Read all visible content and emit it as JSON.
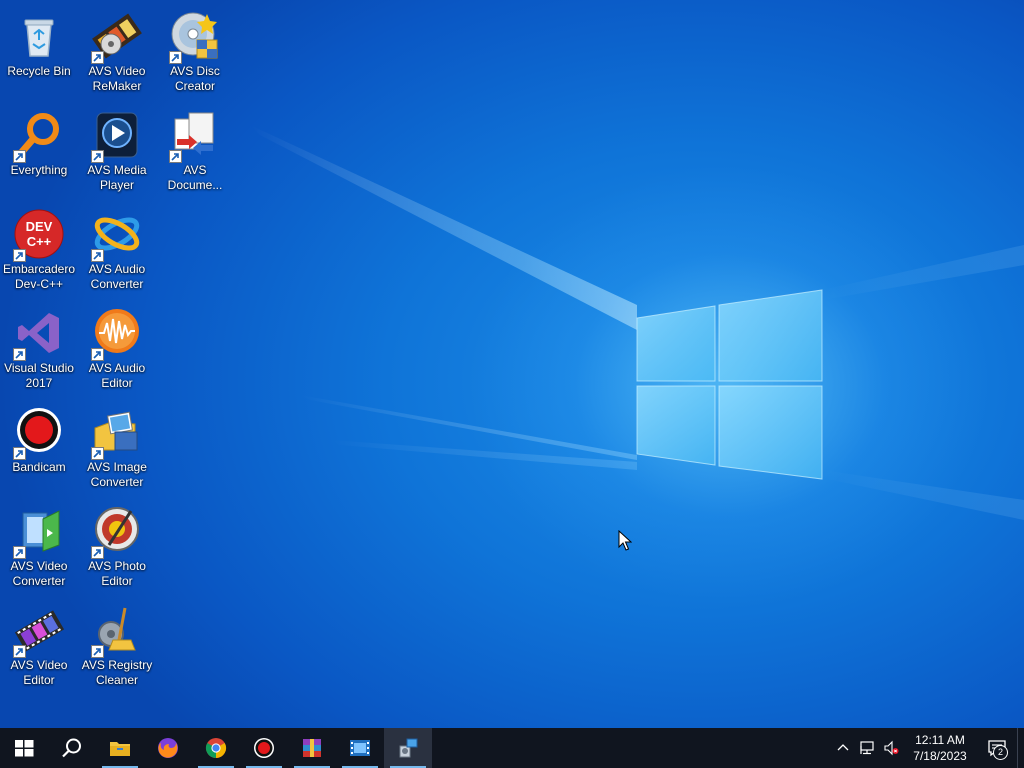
{
  "desktop": {
    "icons": [
      {
        "id": "recycle-bin",
        "label": "Recycle Bin",
        "shortcut": false
      },
      {
        "id": "everything",
        "label": "Everything",
        "shortcut": true
      },
      {
        "id": "devcpp",
        "label": "Embarcadero\nDev-C++",
        "shortcut": true,
        "logo_text": "DEV\nC++"
      },
      {
        "id": "vs2017",
        "label": "Visual Studio\n2017",
        "shortcut": true
      },
      {
        "id": "bandicam",
        "label": "Bandicam",
        "shortcut": true
      },
      {
        "id": "avs-video-converter",
        "label": "AVS Video\nConverter",
        "shortcut": true
      },
      {
        "id": "avs-video-editor",
        "label": "AVS Video\nEditor",
        "shortcut": true
      },
      {
        "id": "avs-video-remaker",
        "label": "AVS Video\nReMaker",
        "shortcut": true
      },
      {
        "id": "avs-media-player",
        "label": "AVS Media\nPlayer",
        "shortcut": true
      },
      {
        "id": "avs-audio-converter",
        "label": "AVS Audio\nConverter",
        "shortcut": true
      },
      {
        "id": "avs-audio-editor",
        "label": "AVS Audio\nEditor",
        "shortcut": true
      },
      {
        "id": "avs-image-converter",
        "label": "AVS Image\nConverter",
        "shortcut": true
      },
      {
        "id": "avs-photo-editor",
        "label": "AVS Photo\nEditor",
        "shortcut": true
      },
      {
        "id": "avs-registry-cleaner",
        "label": "AVS Registry\nCleaner",
        "shortcut": true
      },
      {
        "id": "avs-disc-creator",
        "label": "AVS Disc\nCreator",
        "shortcut": true
      },
      {
        "id": "avs-document-converter",
        "label": "AVS\nDocume...",
        "shortcut": true
      }
    ]
  },
  "taskbar": {
    "buttons": [
      {
        "id": "start",
        "icon": "windows-logo-icon",
        "running": false
      },
      {
        "id": "search",
        "icon": "search-icon",
        "running": false
      },
      {
        "id": "file-explorer",
        "icon": "folder-icon",
        "running": true
      },
      {
        "id": "firefox",
        "icon": "firefox-icon",
        "running": false
      },
      {
        "id": "chrome",
        "icon": "chrome-icon",
        "running": true
      },
      {
        "id": "bandicam",
        "icon": "record-icon",
        "running": true
      },
      {
        "id": "winrar",
        "icon": "winrar-icon",
        "running": true
      },
      {
        "id": "film-app",
        "icon": "film-icon",
        "running": true
      },
      {
        "id": "installer",
        "icon": "installer-icon",
        "running": true,
        "active": true
      }
    ],
    "tray": {
      "time": "12:11 AM",
      "date": "7/18/2023",
      "notification_count": "2"
    }
  },
  "colors": {
    "taskbar": "#10151f",
    "desktop": "#0f74d8",
    "indicator": "#76b9ed"
  }
}
